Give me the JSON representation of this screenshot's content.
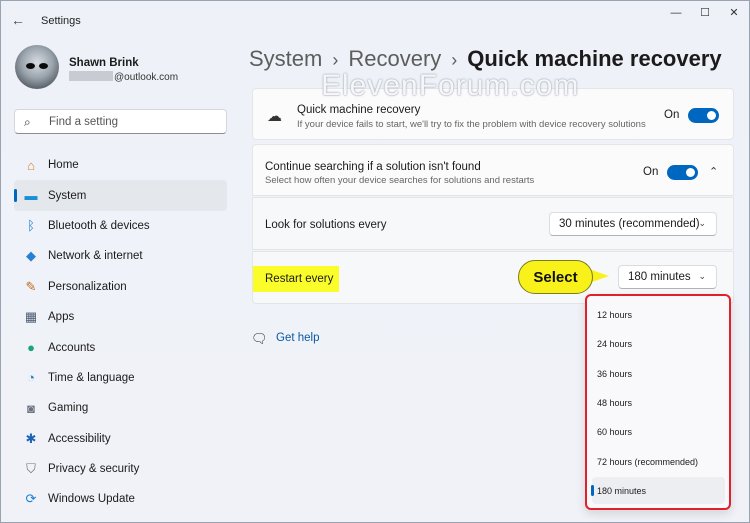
{
  "window": {
    "app_title": "Settings",
    "back_icon": "←",
    "minimize": "—",
    "maximize": "☐",
    "close": "✕"
  },
  "profile": {
    "name": "Shawn Brink",
    "email": "@outlook.com"
  },
  "search": {
    "placeholder": "Find a setting"
  },
  "sidebar": {
    "items": [
      {
        "label": "Home",
        "icon": "home-icon",
        "glyph": "⌂",
        "color": "#d9822b"
      },
      {
        "label": "System",
        "icon": "system-icon",
        "glyph": "▬",
        "color": "#1a8fd6",
        "active": true
      },
      {
        "label": "Bluetooth & devices",
        "icon": "bluetooth-icon",
        "glyph": "ᛒ",
        "color": "#1677d2"
      },
      {
        "label": "Network & internet",
        "icon": "wifi-icon",
        "glyph": "◆",
        "color": "#2a7fd4"
      },
      {
        "label": "Personalization",
        "icon": "brush-icon",
        "glyph": "✎",
        "color": "#c46a1f"
      },
      {
        "label": "Apps",
        "icon": "apps-icon",
        "glyph": "▦",
        "color": "#4a5a70"
      },
      {
        "label": "Accounts",
        "icon": "person-icon",
        "glyph": "●",
        "color": "#1ba37a"
      },
      {
        "label": "Time & language",
        "icon": "globe-clock-icon",
        "glyph": "◔",
        "color": "#1f86c9"
      },
      {
        "label": "Gaming",
        "icon": "gamepad-icon",
        "glyph": "◙",
        "color": "#6b7280"
      },
      {
        "label": "Accessibility",
        "icon": "accessibility-icon",
        "glyph": "✱",
        "color": "#1c63b8"
      },
      {
        "label": "Privacy & security",
        "icon": "shield-icon",
        "glyph": "⛉",
        "color": "#6b7280"
      },
      {
        "label": "Windows Update",
        "icon": "update-icon",
        "glyph": "⟳",
        "color": "#1a7fd2"
      }
    ]
  },
  "breadcrumb": {
    "part1": "System",
    "sep": "›",
    "part2": "Recovery",
    "current": "Quick machine recovery"
  },
  "watermark": "ElevenForum.com",
  "qmr": {
    "title": "Quick machine recovery",
    "subtitle": "If your device fails to start, we'll try to fix the problem with device recovery solutions",
    "toggle_label": "On"
  },
  "continue": {
    "title": "Continue searching if a solution isn't found",
    "subtitle": "Select how often your device searches for solutions and restarts",
    "toggle_label": "On"
  },
  "look": {
    "label": "Look for solutions every",
    "value": "30 minutes (recommended)"
  },
  "restart": {
    "label": "Restart every",
    "value": "180 minutes"
  },
  "callout": "Select",
  "help": {
    "label": "Get help"
  },
  "menu": {
    "options": [
      "12 hours",
      "24 hours",
      "36 hours",
      "48 hours",
      "60 hours",
      "72 hours (recommended)",
      "180 minutes"
    ],
    "selected_index": 6
  },
  "colors": {
    "accent": "#0067c0",
    "highlight": "#fafd2a",
    "callout": "#f8f21a",
    "menu_border": "#e0202a"
  }
}
